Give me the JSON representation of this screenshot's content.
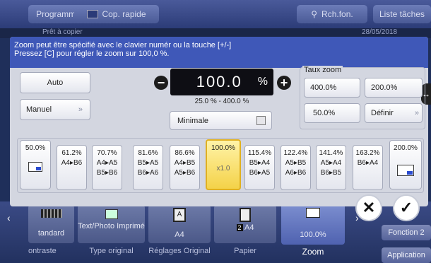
{
  "topbar": {
    "programme": "Programme",
    "cop_rapide": "Cop. rapide",
    "recherche": "Rch.fon.",
    "liste_taches": "Liste tâches"
  },
  "statusbar": {
    "pret": "Prêt à copier",
    "date": "28/05/2018"
  },
  "dialog": {
    "instructions_line1": "Zoom peut être spécifié avec le clavier numér ou la touche [+/-]",
    "instructions_line2": "Pressez [C] pour régler le zoom sur 100,0 %.",
    "auto_label": "Auto",
    "manuel_label": "Manuel",
    "zoom_value": "100.0",
    "zoom_unit": "%",
    "range": "25.0 % - 400.0 %",
    "minimale_label": "Minimale",
    "taux_zoom_title": "Taux zoom",
    "taux_zoom": [
      "400.0%",
      "200.0%",
      "50.0%",
      "Définir"
    ],
    "ratios": [
      {
        "pct": "50.0%",
        "line1": "",
        "line2": ""
      },
      {
        "pct": "61.2%",
        "line1": "A4▸B6",
        "line2": ""
      },
      {
        "pct": "70.7%",
        "line1": "A4▸A5",
        "line2": "B5▸B6"
      },
      {
        "pct": "81.6%",
        "line1": "B5▸A5",
        "line2": "B6▸A6"
      },
      {
        "pct": "86.6%",
        "line1": "A4▸B5",
        "line2": "A5▸B6"
      },
      {
        "pct": "100.0%",
        "line1": "",
        "line2": "x1.0"
      },
      {
        "pct": "115.4%",
        "line1": "B5▸A4",
        "line2": "B6▸A5"
      },
      {
        "pct": "122.4%",
        "line1": "A5▸B5",
        "line2": "A6▸B6"
      },
      {
        "pct": "141.4%",
        "line1": "A5▸A4",
        "line2": "B6▸B5"
      },
      {
        "pct": "163.2%",
        "line1": "B6▸A4",
        "line2": ""
      },
      {
        "pct": "200.0%",
        "line1": "",
        "line2": ""
      }
    ]
  },
  "bottom": {
    "tiles": [
      "tandard",
      "Text/Photo Imprimé",
      "A4",
      "A4",
      "100.0%"
    ],
    "labels": [
      "ontraste",
      "Type original",
      "Réglages Original",
      "Papier",
      "Zoom"
    ],
    "fonction2": "Fonction 2",
    "application": "Application"
  },
  "colors": {
    "accent": "#3f58b8",
    "selected": "#f4d248",
    "background": "#1f2f5a"
  }
}
